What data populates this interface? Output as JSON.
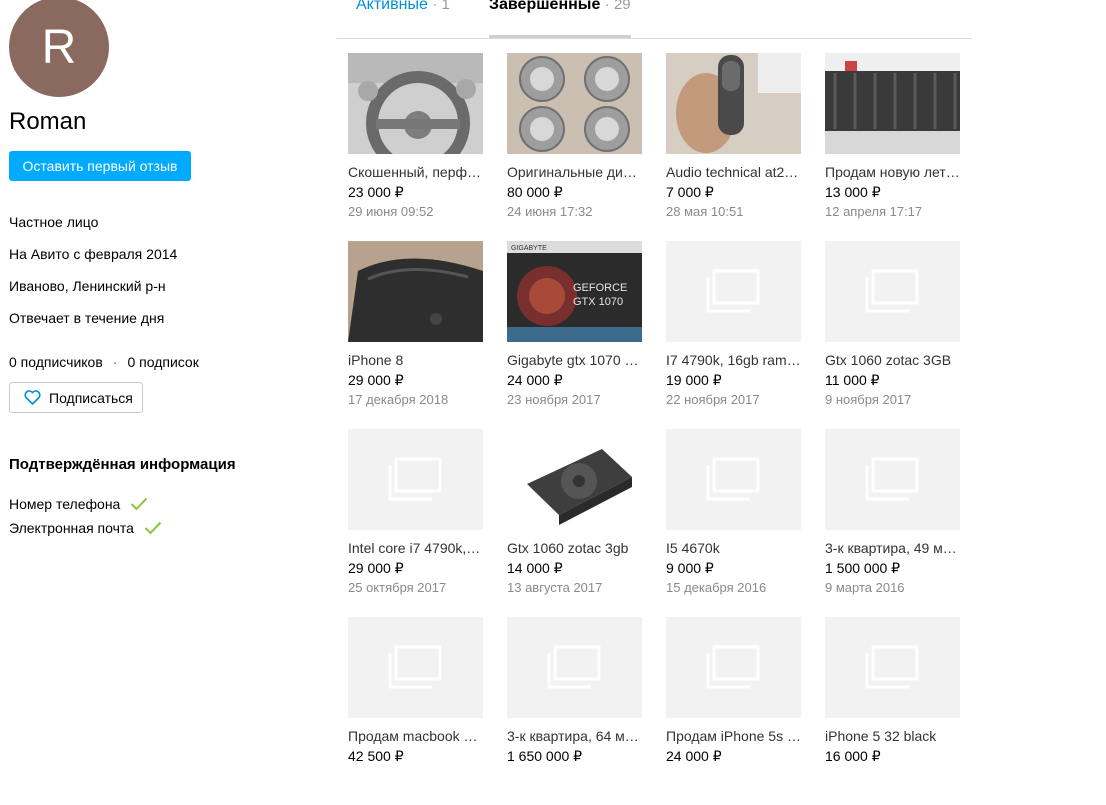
{
  "profile": {
    "avatar_letter": "R",
    "avatar_color": "#8a6a5e",
    "name": "Roman",
    "review_button": "Оставить первый отзыв",
    "info": [
      "Частное лицо",
      "На Авито с февраля 2014",
      "Иваново, Ленинский р-н",
      "Отвечает в течение дня"
    ],
    "subscribers": "0 подписчиков",
    "subscriptions": "0 подписок",
    "separator": "·",
    "subscribe_button": "Подписаться",
    "verified_title": "Подтверждённая информация",
    "verified_items": [
      "Номер телефона",
      "Электронная почта"
    ]
  },
  "tabs": {
    "active": {
      "label": "Активные",
      "separator": "·",
      "count": "1"
    },
    "done": {
      "label": "Завершенные",
      "separator": "·",
      "count": "29"
    }
  },
  "accent_color": "#00aaff",
  "listings": [
    {
      "title": "Скошенный, перф…",
      "price": "23 000 ₽",
      "date": "29 июня 09:52",
      "image": "car-steering-wheel"
    },
    {
      "title": "Оригинальные ди…",
      "price": "80 000 ₽",
      "date": "24 июня 17:32",
      "image": "alloy-wheels"
    },
    {
      "title": "Audio technical at2…",
      "price": "7 000 ₽",
      "date": "28 мая 10:51",
      "image": "microphone"
    },
    {
      "title": "Продам новую лет…",
      "price": "13 000 ₽",
      "date": "12 апреля 17:17",
      "image": "tire"
    },
    {
      "title": "iPhone 8",
      "price": "29 000 ₽",
      "date": "17 декабря 2018",
      "image": "phone"
    },
    {
      "title": "Gigabyte gtx 1070 …",
      "price": "24 000 ₽",
      "date": "23 ноября 2017",
      "image": "gpu-box"
    },
    {
      "title": "I7 4790k, 16gb ram…",
      "price": "19 000 ₽",
      "date": "22 ноября 2017",
      "image": "placeholder"
    },
    {
      "title": "Gtx 1060 zotac 3GB",
      "price": "11 000 ₽",
      "date": "9 ноября 2017",
      "image": "placeholder"
    },
    {
      "title": "Intel core i7 4790k,…",
      "price": "29 000 ₽",
      "date": "25 октября 2017",
      "image": "placeholder"
    },
    {
      "title": "Gtx 1060 zotac 3gb",
      "price": "14 000 ₽",
      "date": "13 августа 2017",
      "image": "gpu-card"
    },
    {
      "title": "I5 4670k",
      "price": "9 000 ₽",
      "date": "15 декабря 2016",
      "image": "placeholder"
    },
    {
      "title": "3-к квартира, 49 м…",
      "price": "1 500 000 ₽",
      "date": "9 марта 2016",
      "image": "placeholder"
    },
    {
      "title": "Продам macbook …",
      "price": "42 500 ₽",
      "date": "",
      "image": "placeholder"
    },
    {
      "title": "3-к квартира, 64 м…",
      "price": "1 650 000 ₽",
      "date": "",
      "image": "placeholder"
    },
    {
      "title": "Продам iPhone 5s …",
      "price": "24 000 ₽",
      "date": "",
      "image": "placeholder"
    },
    {
      "title": "iPhone 5 32 black",
      "price": "16 000 ₽",
      "date": "",
      "image": "placeholder"
    }
  ]
}
